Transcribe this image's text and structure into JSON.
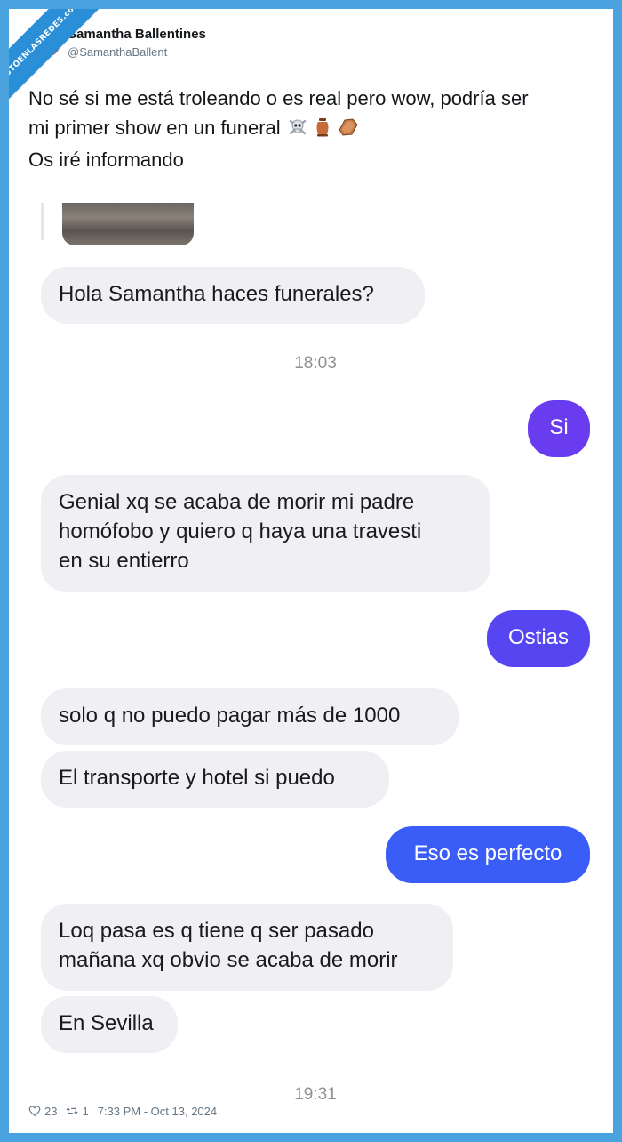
{
  "watermark": "VISTOENLASREDES.com",
  "tweet": {
    "author_name": "Samantha Ballentines",
    "author_handle": "@SamanthaBallent",
    "text_line1": "No sé si me está troleando o es real pero wow, podría ser",
    "text_line2": "mi primer show en un funeral",
    "text_line2_emojis": [
      "skull-and-crossbones-icon",
      "urn-icon",
      "coffin-icon"
    ],
    "text_line3": "Os iré informando"
  },
  "chat": {
    "messages": [
      {
        "side": "in",
        "text": "Hola Samantha haces funerales?"
      },
      {
        "side": "time",
        "text": "18:03"
      },
      {
        "side": "out",
        "text": "Si",
        "color": "#6a3cf0"
      },
      {
        "side": "in",
        "lines": [
          "Genial xq se acaba de morir mi padre",
          "homófobo y quiero q haya una travesti",
          "en su entierro"
        ]
      },
      {
        "side": "out",
        "text": "Ostias",
        "color": "#5646f2"
      },
      {
        "side": "in",
        "text": "solo q no puedo pagar más de 1000"
      },
      {
        "side": "in",
        "text": "El transporte y hotel si puedo"
      },
      {
        "side": "out",
        "text": "Eso es perfecto",
        "color": "#3a5cf7"
      },
      {
        "side": "in",
        "lines": [
          "Loq pasa es q tiene q ser pasado",
          "mañana xq obvio se acaba de morir"
        ]
      },
      {
        "side": "in",
        "text": "En Sevilla"
      },
      {
        "side": "time",
        "text": "19:31"
      }
    ]
  },
  "footer": {
    "likes": "23",
    "retweets": "1",
    "timestamp": "7:33 PM - Oct 13, 2024"
  },
  "colors": {
    "frame": "#4aa3df",
    "incoming_bubble": "#efeff4",
    "text_primary": "#14171a",
    "text_secondary": "#657786"
  }
}
